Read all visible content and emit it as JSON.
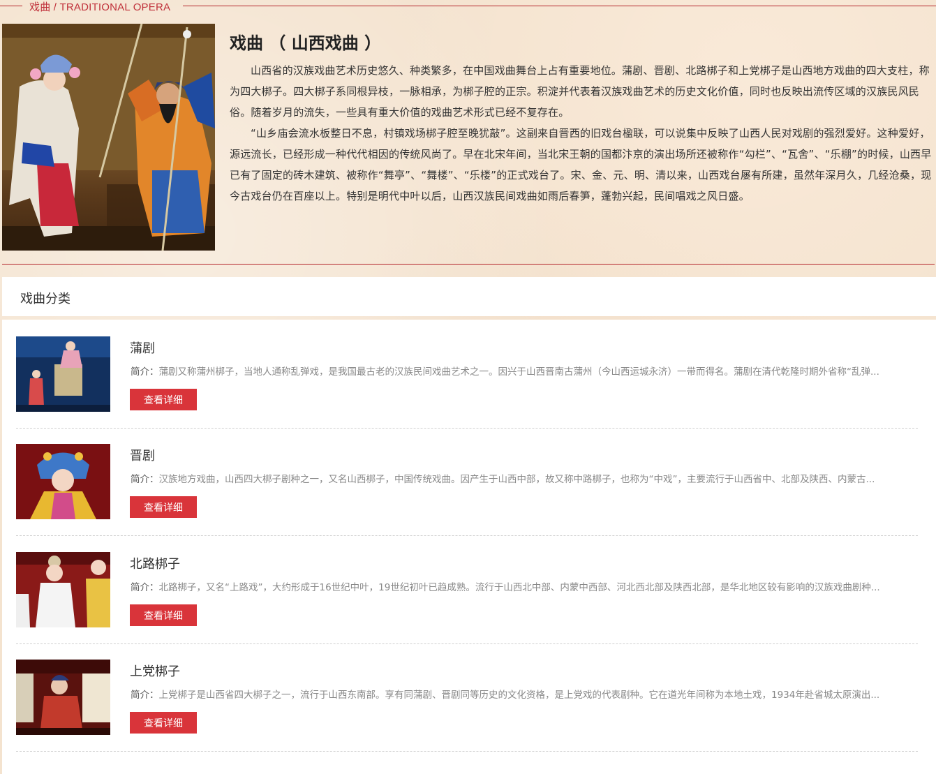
{
  "section_heading": "戏曲 / TRADITIONAL OPERA",
  "intro": {
    "title": "戏曲 （ 山西戏曲 ）",
    "paragraphs": [
      "山西省的汉族戏曲艺术历史悠久、种类繁多，在中国戏曲舞台上占有重要地位。蒲剧、晋剧、北路梆子和上党梆子是山西地方戏曲的四大支柱，称为四大梆子。四大梆子系同根异枝，一脉相承，为梆子腔的正宗。积淀并代表着汉族戏曲艺术的历史文化价值，同时也反映出流传区域的汉族民风民俗。随着岁月的流失，一些具有重大价值的戏曲艺术形式已经不复存在。",
      "“山乡庙会流水板整日不息，村镇戏场梆子腔至晚犹敲”。这副来自晋西的旧戏台楹联，可以说集中反映了山西人民对戏剧的强烈爱好。这种爱好，源远流长，已经形成一种代代相因的传统风尚了。早在北宋年间，当北宋王朝的国都汴京的演出场所还被称作“勾栏”、“瓦舍”、“乐棚”的时候，山西早已有了固定的砖木建筑、被称作“舞亭”、“舞楼”、“乐楼”的正式戏台了。宋、金、元、明、清以来，山西戏台屡有所建，虽然年深月久，几经沧桑，现今古戏台仍在百座以上。特别是明代中叶以后，山西汉族民间戏曲如雨后春笋，蓬勃兴起，民间唱戏之风日盛。"
    ]
  },
  "category": {
    "title": "戏曲分类",
    "items": [
      {
        "name": "蒲剧",
        "desc_prefix": "简介：",
        "desc": "蒲剧又称蒲州梆子，当地人通称乱弹戏，是我国最古老的汉族民间戏曲艺术之一。因兴于山西晋南古蒲州（今山西运城永济）一带而得名。蒲剧在清代乾隆时期外省称“乱弹...",
        "button": "查看详细"
      },
      {
        "name": "晋剧",
        "desc_prefix": "简介：",
        "desc": "汉族地方戏曲，山西四大梆子剧种之一，又名山西梆子，中国传统戏曲。因产生于山西中部，故又称中路梆子，也称为“中戏”，主要流行于山西省中、北部及陕西、内蒙古...",
        "button": "查看详细"
      },
      {
        "name": "北路梆子",
        "desc_prefix": "简介：",
        "desc": "北路梆子，又名“上路戏”，大约形成于16世纪中叶，19世纪初叶已趋成熟。流行于山西北中部、内蒙中西部、河北西北部及陕西北部，是华北地区较有影响的汉族戏曲剧种...",
        "button": "查看详细"
      },
      {
        "name": "上党梆子",
        "desc_prefix": "简介：",
        "desc": "上党梆子是山西省四大梆子之一，流行于山西东南部。享有同蒲剧、晋剧同等历史的文化资格，是上党戏的代表剧种。它在道光年间称为本地土戏，1934年赴省城太原演出...",
        "button": "查看详细"
      }
    ]
  },
  "colors": {
    "accent_red": "#d9343a",
    "line_red": "#b3242a",
    "background": "#f4e3cf"
  }
}
